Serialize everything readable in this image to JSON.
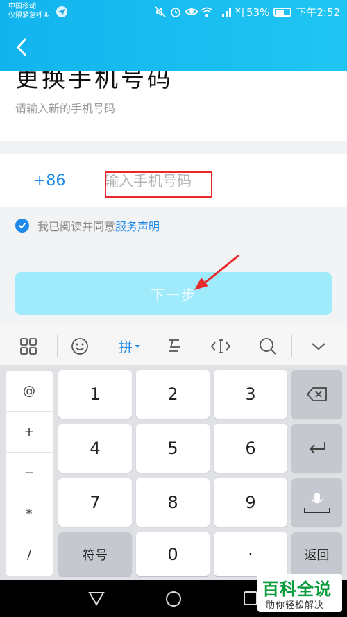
{
  "status_bar": {
    "carrier_line1": "中国移动",
    "carrier_line2": "仅限紧急呼叫",
    "battery": "53%",
    "time": "下午2:52"
  },
  "page": {
    "title_fragment": "更换手机号码",
    "subtitle": "请输入新的手机号码",
    "country_code": "+86",
    "phone_placeholder": "输入手机号码",
    "agree_text": "我已阅读并同意",
    "agree_link": "服务声明",
    "next_button": "下一步"
  },
  "keyboard": {
    "toolbar_mode_label": "拼",
    "symbols": [
      "@",
      "+",
      "−",
      "*",
      "/"
    ],
    "digits": [
      "1",
      "2",
      "3",
      "4",
      "5",
      "6",
      "7",
      "8",
      "9",
      "0"
    ],
    "symbols_key": "符号",
    "dot_key": "·",
    "return_key": "返回"
  },
  "watermark": {
    "title": "百科全说",
    "subtitle": "助你轻松解决"
  },
  "colors": {
    "header": "#12b4ee",
    "accent": "#1e8bea",
    "button_disabled": "#9feafb",
    "annotation_red": "#e8292c"
  }
}
